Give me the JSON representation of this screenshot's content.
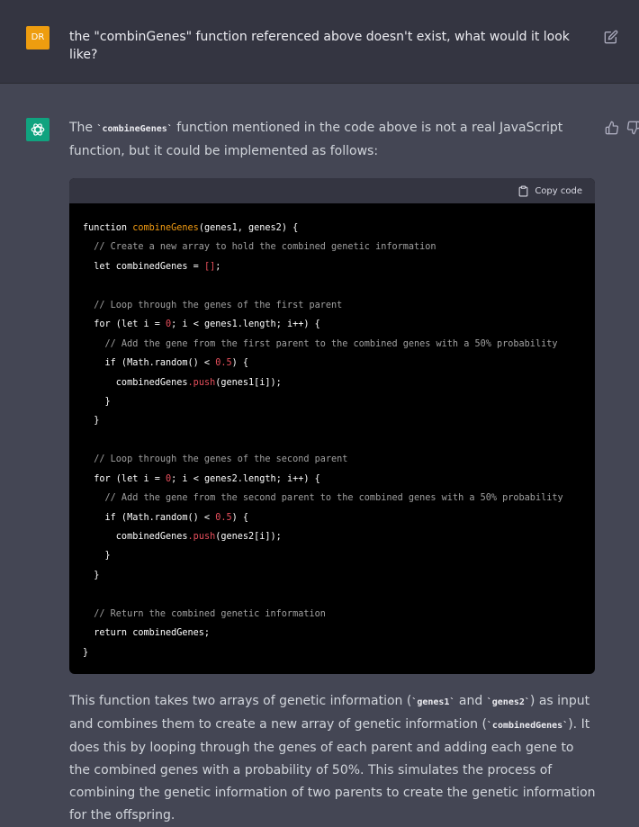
{
  "user_message": {
    "avatar_initials": "DR",
    "avatar_color": "#ee9d0f",
    "text": "the \"combinGenes\" function referenced above doesn't exist, what would it look like?",
    "edit_icon": "edit-icon"
  },
  "assistant_message": {
    "avatar_color": "#10a37f",
    "avatar_icon": "openai-logo-icon",
    "intro": {
      "before": "The ",
      "code": "`combineGenes`",
      "after": " function mentioned in the code above is not a real JavaScript function, but it could be implemented as follows:"
    },
    "code_block": {
      "copy_label": "Copy code",
      "lines": [
        [
          {
            "t": "function ",
            "c": "kw"
          },
          {
            "t": "combineGenes",
            "c": "fn"
          },
          {
            "t": "(genes1, genes2) {",
            "c": "plain"
          }
        ],
        [
          {
            "t": "  // Create a new array to hold the combined genetic information",
            "c": "comment"
          }
        ],
        [
          {
            "t": "  let combinedGenes = ",
            "c": "plain"
          },
          {
            "t": "[]",
            "c": "num"
          },
          {
            "t": ";",
            "c": "plain"
          }
        ],
        [],
        [
          {
            "t": "  // Loop through the genes of the first parent",
            "c": "comment"
          }
        ],
        [
          {
            "t": "  for (let i = ",
            "c": "plain"
          },
          {
            "t": "0",
            "c": "num"
          },
          {
            "t": "; i < genes1.length; i++) {",
            "c": "plain"
          }
        ],
        [
          {
            "t": "    // Add the gene from the first parent to the combined genes with a 50% probability",
            "c": "comment"
          }
        ],
        [
          {
            "t": "    if (Math.random() < ",
            "c": "plain"
          },
          {
            "t": "0.5",
            "c": "num"
          },
          {
            "t": ") {",
            "c": "plain"
          }
        ],
        [
          {
            "t": "      combinedGenes",
            "c": "plain"
          },
          {
            "t": ".push",
            "c": "method"
          },
          {
            "t": "(genes1[i]);",
            "c": "plain"
          }
        ],
        [
          {
            "t": "    }",
            "c": "plain"
          }
        ],
        [
          {
            "t": "  }",
            "c": "plain"
          }
        ],
        [],
        [
          {
            "t": "  // Loop through the genes of the second parent",
            "c": "comment"
          }
        ],
        [
          {
            "t": "  for (let i = ",
            "c": "plain"
          },
          {
            "t": "0",
            "c": "num"
          },
          {
            "t": "; i < genes2.length; i++) {",
            "c": "plain"
          }
        ],
        [
          {
            "t": "    // Add the gene from the second parent to the combined genes with a 50% probability",
            "c": "comment"
          }
        ],
        [
          {
            "t": "    if (Math.random() < ",
            "c": "plain"
          },
          {
            "t": "0.5",
            "c": "num"
          },
          {
            "t": ") {",
            "c": "plain"
          }
        ],
        [
          {
            "t": "      combinedGenes",
            "c": "plain"
          },
          {
            "t": ".push",
            "c": "method"
          },
          {
            "t": "(genes2[i]);",
            "c": "plain"
          }
        ],
        [
          {
            "t": "    }",
            "c": "plain"
          }
        ],
        [
          {
            "t": "  }",
            "c": "plain"
          }
        ],
        [],
        [
          {
            "t": "  // Return the combined genetic information",
            "c": "comment"
          }
        ],
        [
          {
            "t": "  return combinedGenes;",
            "c": "plain"
          }
        ],
        [
          {
            "t": "}",
            "c": "plain"
          }
        ]
      ]
    },
    "explanation": {
      "s1": "This function takes two arrays of genetic information (",
      "c1": "`genes1`",
      "s2": " and ",
      "c2": "`genes2`",
      "s3": ") as input and combines them to create a new array of genetic information (",
      "c3": "`combinedGenes`",
      "s4": "). It does this by looping through the genes of each parent and adding each gene to the combined genes with a probability of 50%. This simulates the process of combining the genetic information of two parents to create the genetic information for the offspring."
    },
    "feedback_icons": [
      "thumbs-up-icon",
      "thumbs-down-icon"
    ]
  }
}
